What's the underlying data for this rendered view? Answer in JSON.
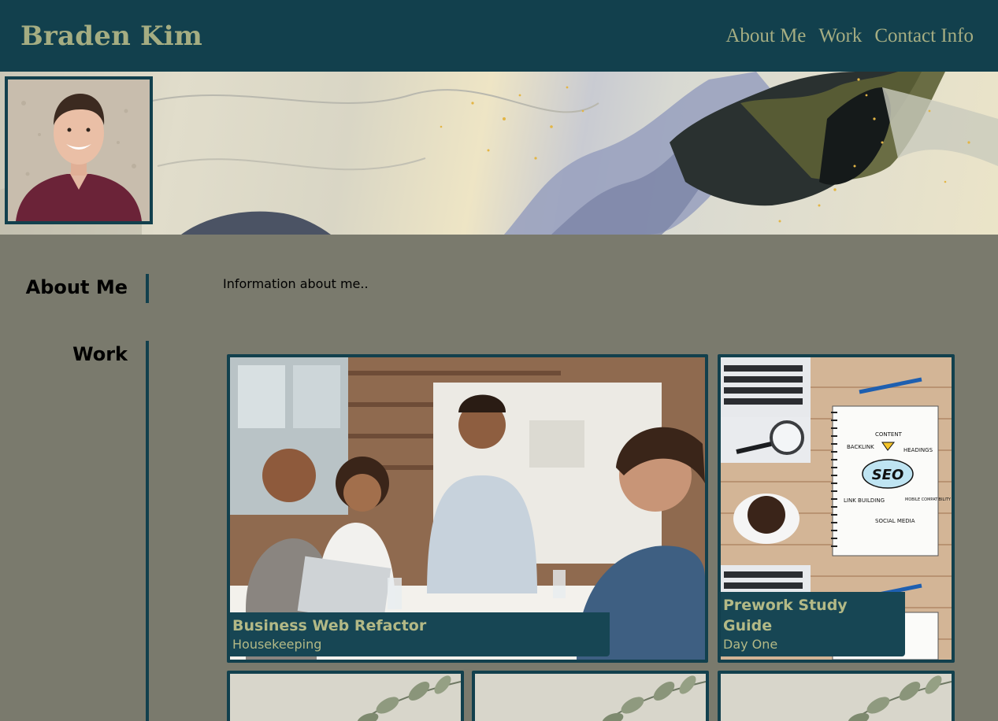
{
  "header": {
    "title": "Braden Kim",
    "nav": [
      "About Me",
      "Work",
      "Contact Info"
    ]
  },
  "sections": {
    "about": {
      "heading": "About Me",
      "text": "Information about me.."
    },
    "work": {
      "heading": "Work"
    }
  },
  "work_cards": [
    {
      "title": "Business Web Refactor",
      "subtitle": "Housekeeping"
    },
    {
      "title": "Prework Study Guide",
      "subtitle": "Day One"
    }
  ],
  "seo_sketch": {
    "center": "SEO",
    "labels": [
      "CONTENT",
      "BACKLINK",
      "HEADINGS",
      "LINK BUILDING",
      "MOBILE COMPATIBILITY",
      "SOCIAL MEDIA"
    ]
  },
  "colors": {
    "header_bg": "#12404d",
    "accent": "#a5ad82",
    "page_bg": "#7a7a6d"
  }
}
